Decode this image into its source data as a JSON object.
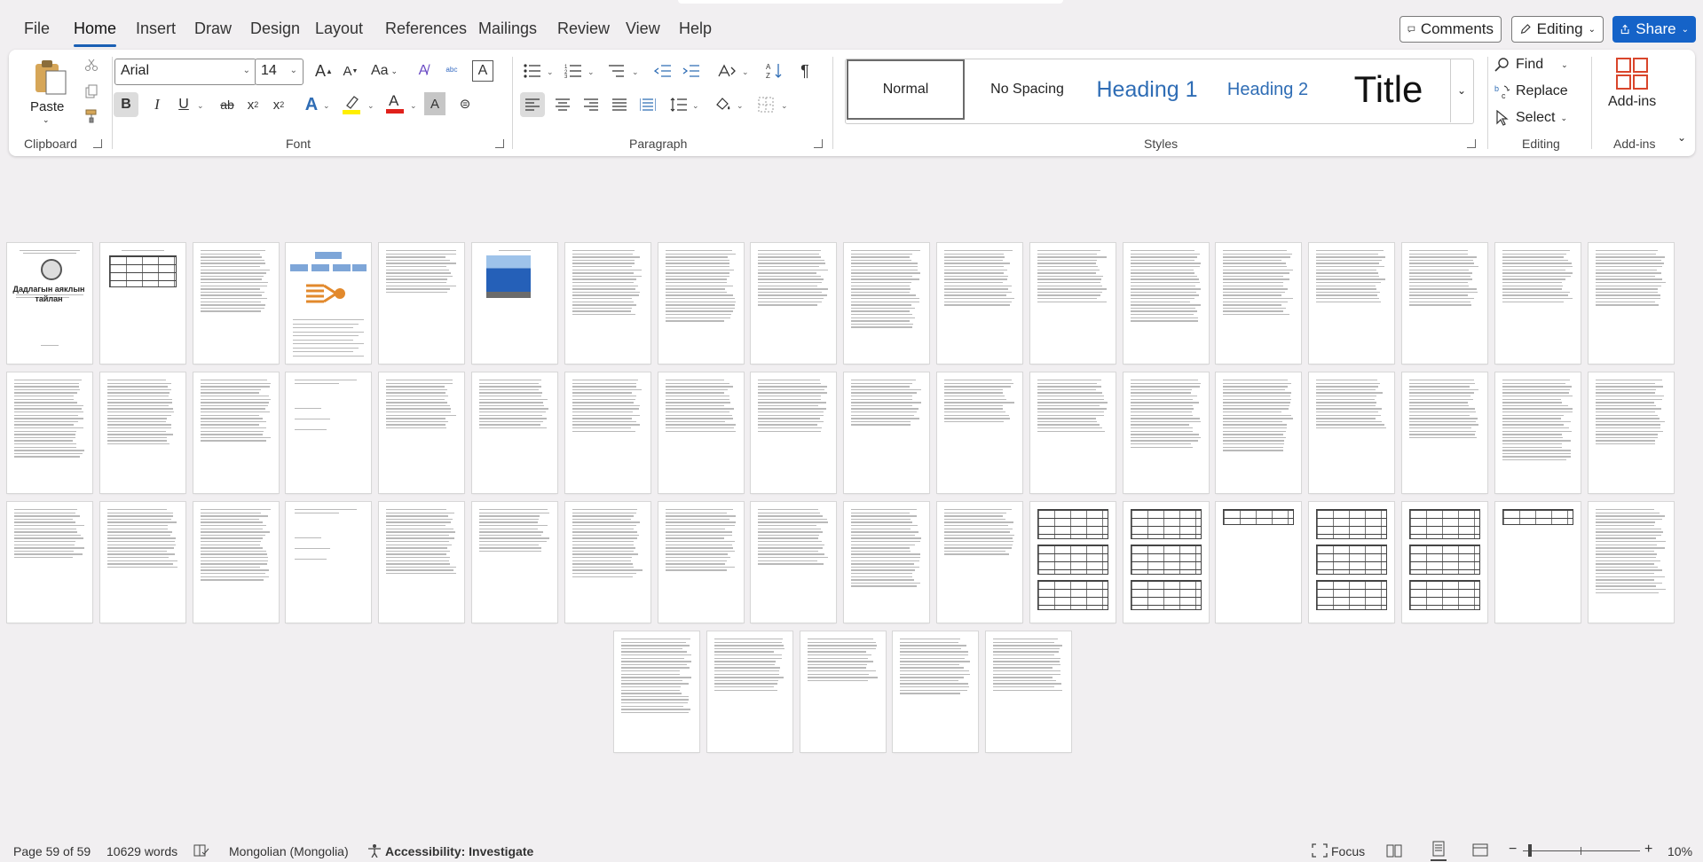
{
  "menu": {
    "tabs": [
      "File",
      "Home",
      "Insert",
      "Draw",
      "Design",
      "Layout",
      "References",
      "Mailings",
      "Review",
      "View",
      "Help"
    ],
    "active": "Home",
    "comments_label": "Comments",
    "editing_label": "Editing",
    "share_label": "Share"
  },
  "ribbon": {
    "clipboard": {
      "paste_label": "Paste",
      "group_label": "Clipboard"
    },
    "font": {
      "font_name": "Arial",
      "font_size": "14",
      "group_label": "Font",
      "highlight_color": "#ffef00",
      "font_color": "#e0201b"
    },
    "paragraph": {
      "group_label": "Paragraph"
    },
    "styles": {
      "items": [
        "Normal",
        "No Spacing",
        "Heading 1",
        "Heading 2",
        "Title"
      ],
      "group_label": "Styles",
      "heading_color": "#2f6db5"
    },
    "editing": {
      "find_label": "Find",
      "replace_label": "Replace",
      "select_label": "Select",
      "group_label": "Editing"
    },
    "addins": {
      "addins_label": "Add-ins",
      "group_label": "Add-ins",
      "icon_color": "#d9452b"
    }
  },
  "document": {
    "cover_title": "Дадлагын аяклын тайлан"
  },
  "status": {
    "page": "Page 59 of 59",
    "words": "10629 words",
    "language": "Mongolian (Mongolia)",
    "accessibility": "Accessibility: Investigate",
    "focus": "Focus",
    "zoom": "10%"
  }
}
